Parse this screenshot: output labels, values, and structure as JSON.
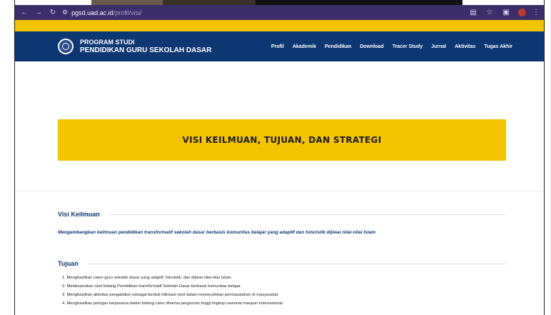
{
  "browser": {
    "nav": {
      "back_icon": "back-arrow-icon",
      "forward_icon": "forward-arrow-icon",
      "reload_icon": "reload-icon"
    },
    "url_host": "pgsd.uad.ac.id",
    "url_path": "/profil/visi/",
    "theme_color": "#3a2f6b"
  },
  "site": {
    "accent_yellow": "#f5c400",
    "brand_blue": "#0d3773",
    "brand_line1": "PROGRAM STUDI",
    "brand_line2": "PENDIDIKAN GURU SEKOLAH DASAR",
    "menu": [
      {
        "label": "Profil"
      },
      {
        "label": "Akademik"
      },
      {
        "label": "Pendidikan"
      },
      {
        "label": "Download"
      },
      {
        "label": "Tracer Study"
      },
      {
        "label": "Jurnal"
      },
      {
        "label": "Aktivitas"
      },
      {
        "label": "Tugas Akhir"
      }
    ]
  },
  "hero": {
    "title": "VISI KEILMUAN, TUJUAN, DAN STRATEGI"
  },
  "vision": {
    "heading": "Visi Keilmuan",
    "text": "Mengembangkan keilmuan pendidikan transformatif sekolah dasar berbasis komunitas belajar yang adaptif dan futuristik dijiwai nilai-nilai Islam"
  },
  "goals": {
    "heading": "Tujuan",
    "items": [
      "1. Menghasilkan calon guru sekolah dasar yang adaptif, futuristik, dan dijiwai nilai-nilai Islam.",
      "2. Melaksanakan riset bidang Pendidikan transformatif Sekolah Dasar berbasis komunitas belajar.",
      "3. Menghasilkan aktivitas pengabdian sebagai bentuk hilirisasi riset dalam memecahkan permasalahan di masyarakat.",
      "4. Menghasilkan jaringan kerjasama dalam bidang catur dharma perguruan tinggi lingkup nasional maupun internasional."
    ]
  }
}
